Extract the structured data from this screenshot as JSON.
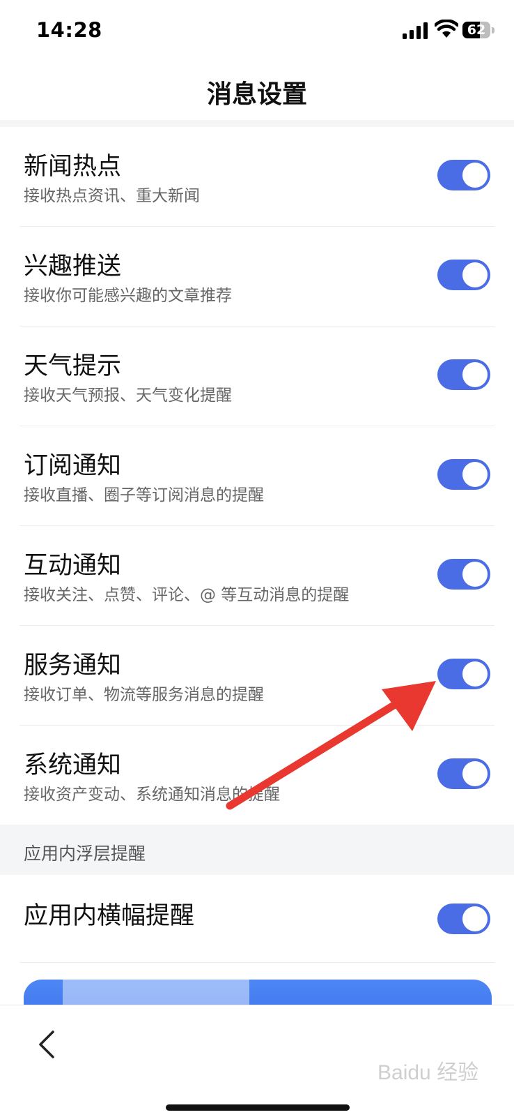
{
  "status_bar": {
    "time": "14:28",
    "battery": "62",
    "battery_level": 0.62
  },
  "nav": {
    "title": "消息设置"
  },
  "settings": [
    {
      "title": "新闻热点",
      "subtitle": "接收热点资讯、重大新闻",
      "enabled": true
    },
    {
      "title": "兴趣推送",
      "subtitle": "接收你可能感兴趣的文章推荐",
      "enabled": true
    },
    {
      "title": "天气提示",
      "subtitle": "接收天气预报、天气变化提醒",
      "enabled": true
    },
    {
      "title": "订阅通知",
      "subtitle": "接收直播、圈子等订阅消息的提醒",
      "enabled": true
    },
    {
      "title": "互动通知",
      "subtitle": "接收关注、点赞、评论、@ 等互动消息的提醒",
      "enabled": true
    },
    {
      "title": "服务通知",
      "subtitle": "接收订单、物流等服务消息的提醒",
      "enabled": true
    },
    {
      "title": "系统通知",
      "subtitle": "接收资产变动、系统通知消息的提醒",
      "enabled": true
    }
  ],
  "section": {
    "label": "应用内浮层提醒"
  },
  "banner_setting": {
    "title": "应用内横幅提醒",
    "enabled": true
  },
  "colors": {
    "accent": "#4a6de5",
    "annotation": "#e8382f"
  },
  "watermark": "Baidu 经验"
}
